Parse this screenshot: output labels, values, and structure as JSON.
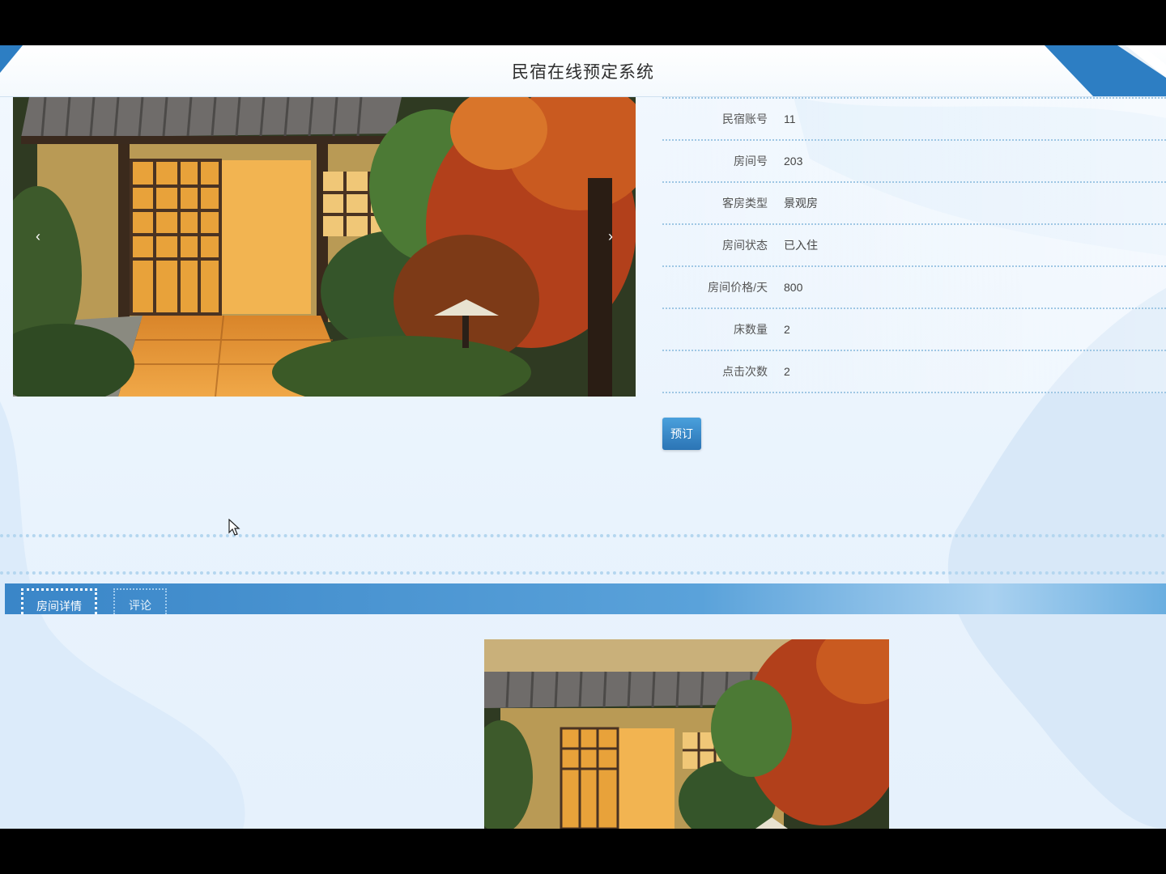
{
  "header": {
    "title": "民宿在线预定系统"
  },
  "carousel": {
    "prev_icon": "chevron-left-icon",
    "next_icon": "chevron-right-icon",
    "prev_glyph": "‹",
    "next_glyph": "›"
  },
  "details": [
    {
      "label": "民宿账号",
      "value": "11"
    },
    {
      "label": "房间号",
      "value": "203"
    },
    {
      "label": "客房类型",
      "value": "景观房"
    },
    {
      "label": "房间状态",
      "value": "已入住"
    },
    {
      "label": "房间价格/天",
      "value": "800"
    },
    {
      "label": "床数量",
      "value": "2"
    },
    {
      "label": "点击次数",
      "value": "2"
    }
  ],
  "actions": {
    "book_label": "预订"
  },
  "tabs": [
    {
      "label": "房间详情",
      "active": true
    },
    {
      "label": "评论",
      "active": false
    }
  ],
  "colors": {
    "accent": "#2d7ec3",
    "tab_bar": "#3a86c8",
    "dotted_line": "#9fc7e4"
  }
}
